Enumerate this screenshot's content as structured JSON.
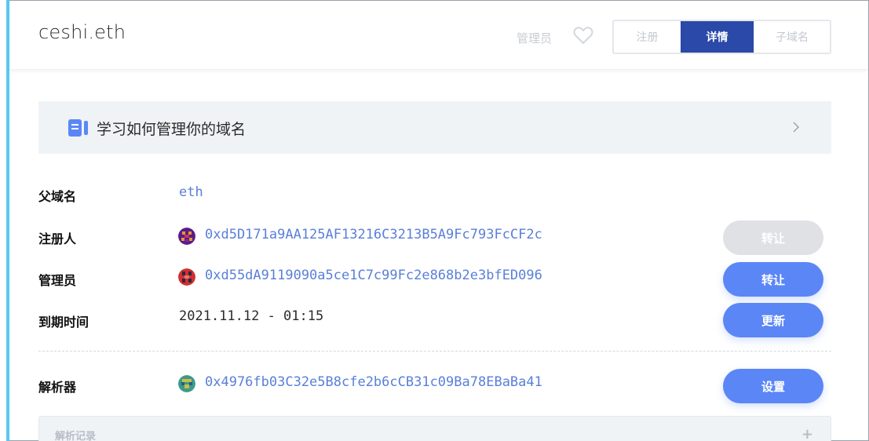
{
  "header": {
    "domain": "ceshi.eth",
    "manager_label": "管理员",
    "tabs": [
      {
        "label": "注册",
        "active": false
      },
      {
        "label": "详情",
        "active": true
      },
      {
        "label": "子域名",
        "active": false
      }
    ]
  },
  "banner": {
    "text": "学习如何管理你的域名",
    "icon": "book-icon"
  },
  "details": {
    "parent": {
      "label": "父域名",
      "value": "eth"
    },
    "registrant": {
      "label": "注册人",
      "address": "0xd5D171a9AA125AF13216C3213B5A9Fc793FcCF2c",
      "button": "转让",
      "button_enabled": false
    },
    "controller": {
      "label": "管理员",
      "address": "0xd55dA9119090a5ce1C7c99Fc2e868b2e3bfED096",
      "button": "转让",
      "button_enabled": true
    },
    "expiry": {
      "label": "到期时间",
      "value": "2021.11.12 - 01:15",
      "button": "更新"
    },
    "resolver": {
      "label": "解析器",
      "address": "0x4976fb03C32e5B8cfe2b6cCB31c09Ba78EBaBa41",
      "button": "设置"
    },
    "records": {
      "label": "解析记录",
      "action": "+"
    }
  },
  "colors": {
    "primary": "#5b86f6",
    "tab_active": "#2a49a8",
    "address": "#5a7fd8",
    "accent_bar": "#5ac8f0"
  }
}
